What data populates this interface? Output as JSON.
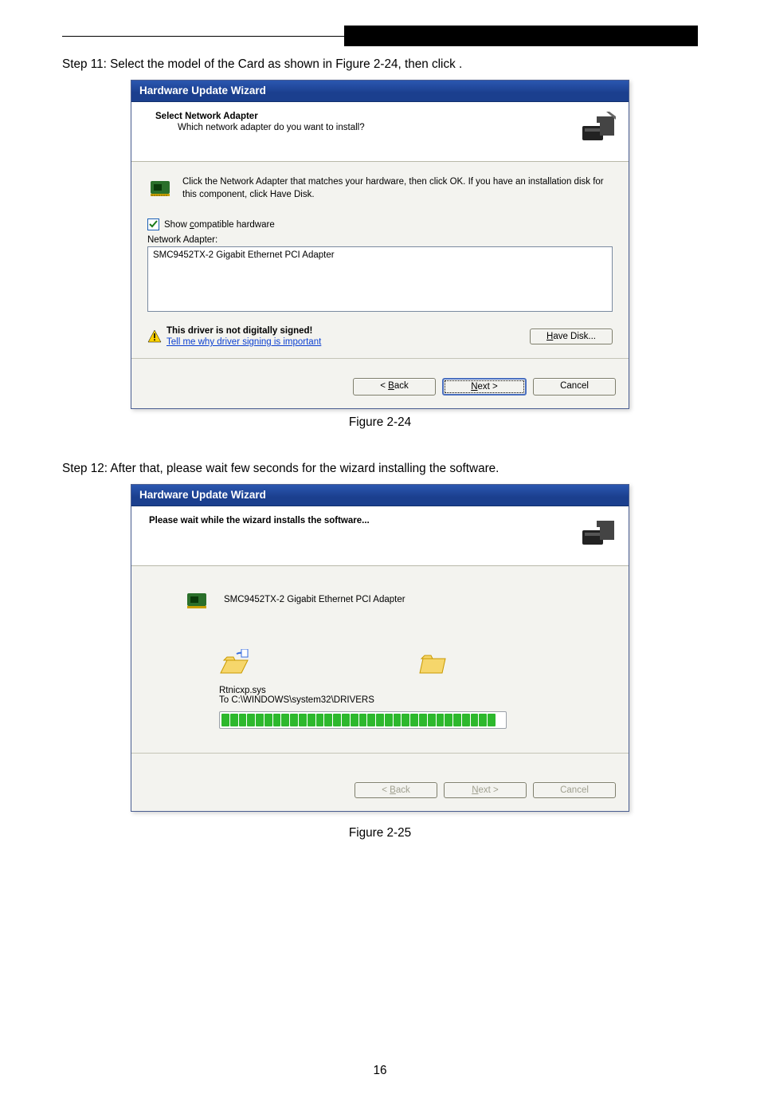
{
  "steps": {
    "s11": "Step 11: Select the model of the Card as shown in Figure 2-24, then click       .",
    "s12": "Step 12: After that, please wait few seconds for the wizard installing the software."
  },
  "fig1_caption": "Figure 2-24",
  "fig2_caption": "Figure 2-25",
  "page_number": "16",
  "wizard1": {
    "title": "Hardware Update Wizard",
    "header_title": "Select Network Adapter",
    "header_sub": "Which network adapter do you want to install?",
    "info": "Click the Network Adapter that matches your hardware, then click OK. If you have an installation disk for this component, click Have Disk.",
    "show_compat_prefix": "Show ",
    "show_compat_uchar": "c",
    "show_compat_suffix": "ompatible hardware",
    "na_label": "Network Adapter:",
    "na_item": "SMC9452TX-2 Gigabit Ethernet PCI Adapter",
    "signed_bold": "This driver is not digitally signed!",
    "tell_link_prefix": "T",
    "tell_link_rest": "ell me why driver signing is important",
    "have_disk_u": "H",
    "have_disk_rest": "ave Disk...",
    "back_lt": "< ",
    "back_u": "B",
    "back_rest": "ack",
    "next_u": "N",
    "next_rest": "ext >",
    "cancel": "Cancel"
  },
  "wizard2": {
    "title": "Hardware Update Wizard",
    "header_title": "Please wait while the wizard installs the software...",
    "device": "SMC9452TX-2 Gigabit Ethernet PCI Adapter",
    "file": "Rtnicxp.sys",
    "dest": "To C:\\WINDOWS\\system32\\DRIVERS",
    "back_lt": "< ",
    "back_u": "B",
    "back_rest": "ack",
    "next_u": "N",
    "next_rest": "ext >",
    "cancel": "Cancel"
  }
}
